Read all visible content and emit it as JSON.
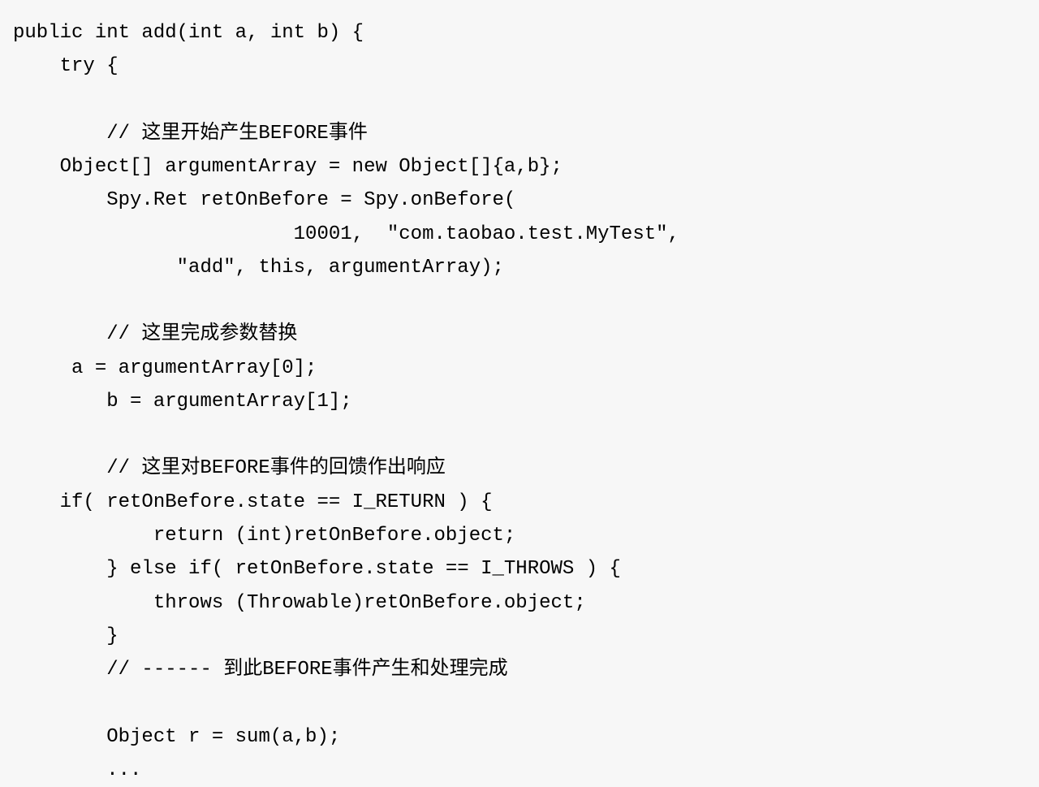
{
  "code": {
    "lines": [
      "public int add(int a, int b) {",
      "    try {",
      "",
      "        // 这里开始产生BEFORE事件",
      "    Object[] argumentArray = new Object[]{a,b};",
      "        Spy.Ret retOnBefore = Spy.onBefore(",
      "                        10001,  \"com.taobao.test.MyTest\",",
      "              \"add\", this, argumentArray);",
      "",
      "        // 这里完成参数替换",
      "     a = argumentArray[0];",
      "        b = argumentArray[1];",
      "",
      "        // 这里对BEFORE事件的回馈作出响应",
      "    if( retOnBefore.state == I_RETURN ) {",
      "            return (int)retOnBefore.object;",
      "        } else if( retOnBefore.state == I_THROWS ) {",
      "            throws (Throwable)retOnBefore.object;",
      "        }",
      "        // ------ 到此BEFORE事件产生和处理完成",
      "",
      "        Object r = sum(a,b);",
      "        ..."
    ]
  }
}
